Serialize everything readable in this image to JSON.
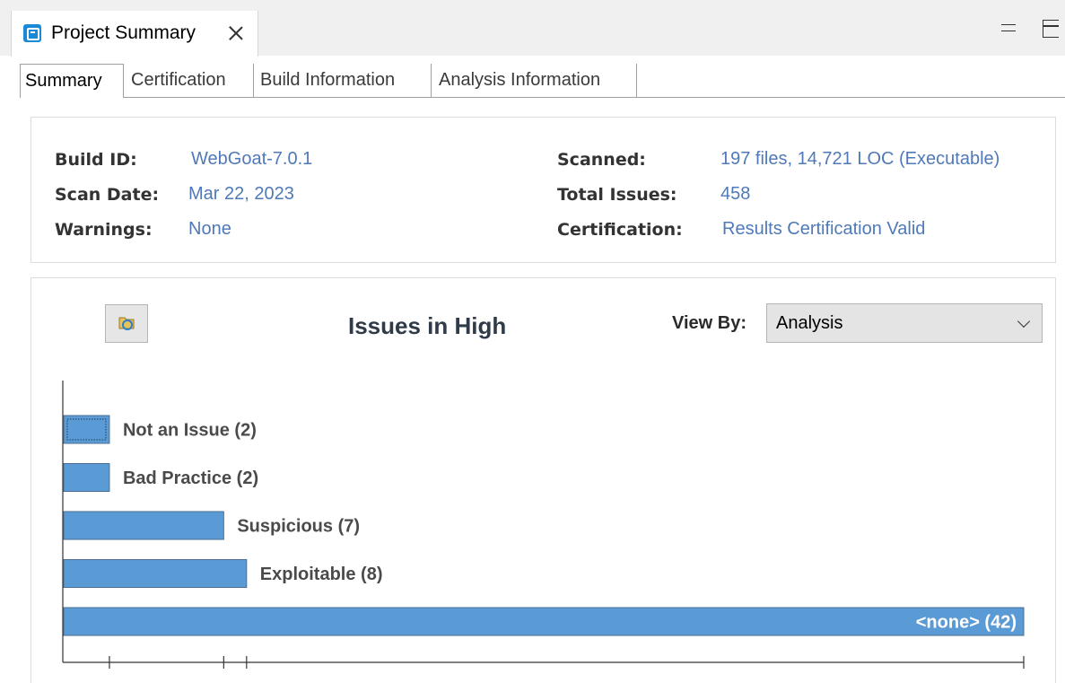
{
  "view": {
    "tab_title": "Project Summary",
    "icons": {
      "tab": "project-summary-icon",
      "close": "close-icon",
      "minimize": "minimize-icon",
      "maximize": "maximize-icon"
    }
  },
  "tabs": [
    {
      "label": "Summary",
      "active": true
    },
    {
      "label": "Certification",
      "active": false
    },
    {
      "label": "Build Information",
      "active": false
    },
    {
      "label": "Analysis Information",
      "active": false
    }
  ],
  "info": {
    "build_id_label": "Build ID:",
    "build_id_value": "WebGoat-7.0.1",
    "scan_date_label": "Scan Date:",
    "scan_date_value": "Mar 22, 2023",
    "warnings_label": "Warnings:",
    "warnings_value": "None",
    "scanned_label": "Scanned:",
    "scanned_value": "197 files, 14,721 LOC (Executable)",
    "total_issues_label": "Total Issues:",
    "total_issues_value": "458",
    "certification_label": "Certification:",
    "certification_value": "Results Certification Valid"
  },
  "chart_panel": {
    "refresh_icon": "refresh-chart-icon",
    "viewby_label": "View By:",
    "viewby_value": "Analysis"
  },
  "colors": {
    "bar_fill": "#5b9bd5",
    "bar_stroke": "#4a6f93",
    "link": "#4f79b8",
    "title": "#303b4a"
  },
  "chart_data": {
    "type": "bar",
    "orientation": "horizontal",
    "title": "Issues in High",
    "categories": [
      "Not an Issue",
      "Bad Practice",
      "Suspicious",
      "Exploitable",
      "<none>"
    ],
    "values": [
      2,
      2,
      7,
      8,
      42
    ],
    "labels": [
      "Not an Issue (2)",
      "Bad Practice (2)",
      "Suspicious (7)",
      "Exploitable (8)",
      "<none> (42)"
    ],
    "selected_index": 0,
    "xlim": [
      0,
      42
    ],
    "grid": false
  }
}
